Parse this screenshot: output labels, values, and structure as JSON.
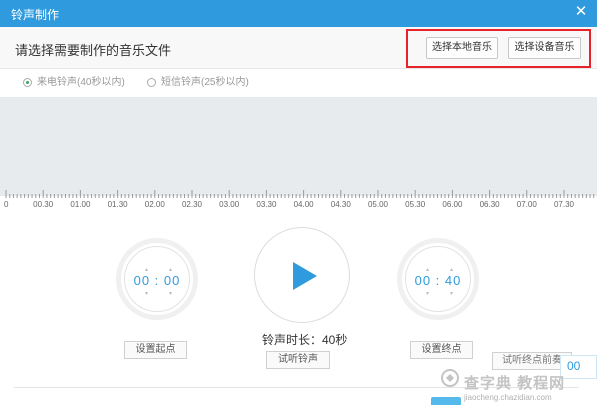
{
  "window": {
    "title": "铃声制作",
    "close_icon": "close-icon"
  },
  "header": {
    "prompt": "请选择需要制作的音乐文件",
    "local_music_label": "选择本地音乐",
    "device_music_label": "选择设备音乐",
    "highlight_color": "#e8222b"
  },
  "ringtone_type": {
    "options": [
      {
        "label": "来电铃声(40秒以内)",
        "selected": true
      },
      {
        "label": "短信铃声(25秒以内)",
        "selected": false
      }
    ]
  },
  "timeline": {
    "ticks": [
      "0",
      "00.30",
      "01.00",
      "01.30",
      "02.00",
      "02.30",
      "03.00",
      "03.30",
      "04.00",
      "04.30",
      "05.00",
      "05.30",
      "06.00",
      "06.30",
      "07.00",
      "07.30"
    ]
  },
  "controls": {
    "start_time": "00 : 00",
    "end_time": "00 : 40",
    "duration_label": "铃声时长：40秒",
    "set_start_label": "设置起点",
    "preview_label": "试听铃声",
    "set_end_label": "设置终点",
    "listen_end_label": "试听终点前奏",
    "play_icon": "play-icon"
  },
  "corner_text": "00",
  "watermark": {
    "line1": "查字典 教程网",
    "line2": "jiaocheng.chazidian.com"
  },
  "colors": {
    "accent": "#2f9bde",
    "titlebar": "#2f9bde",
    "radio_selected": "#3aa45c"
  }
}
